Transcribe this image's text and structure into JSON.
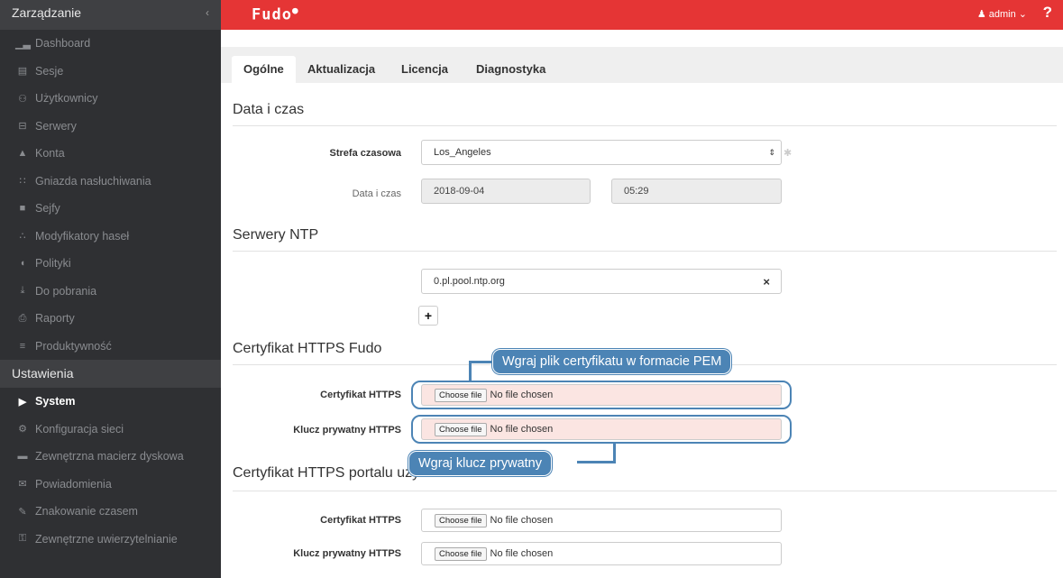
{
  "sidebar": {
    "header": "Zarządzanie",
    "collapse_icon": "chevron-left-icon",
    "items": [
      {
        "label": "Dashboard",
        "icon": "chart-icon"
      },
      {
        "label": "Sesje",
        "icon": "film-icon"
      },
      {
        "label": "Użytkownicy",
        "icon": "users-icon"
      },
      {
        "label": "Serwery",
        "icon": "server-icon"
      },
      {
        "label": "Konta",
        "icon": "user-account-icon"
      },
      {
        "label": "Gniazda nasłuchiwania",
        "icon": "rss-icon"
      },
      {
        "label": "Sejfy",
        "icon": "safe-icon"
      },
      {
        "label": "Modyfikatory haseł",
        "icon": "sitemap-icon"
      },
      {
        "label": "Polityki",
        "icon": "shield-icon"
      },
      {
        "label": "Do pobrania",
        "icon": "download-icon"
      },
      {
        "label": "Raporty",
        "icon": "printer-icon"
      },
      {
        "label": "Produktywność",
        "icon": "list-icon"
      }
    ],
    "section2": "Ustawienia",
    "items2": [
      {
        "label": "System",
        "icon": "folder-open-icon",
        "active": true
      },
      {
        "label": "Konfiguracja sieci",
        "icon": "cogs-icon"
      },
      {
        "label": "Zewnętrzna macierz dyskowa",
        "icon": "hdd-icon"
      },
      {
        "label": "Powiadomienia",
        "icon": "envelope-icon"
      },
      {
        "label": "Znakowanie czasem",
        "icon": "edit-icon"
      },
      {
        "label": "Zewnętrzne uwierzytelnianie",
        "icon": "key-icon"
      }
    ]
  },
  "topbar": {
    "logo": "Fudo",
    "user": "admin",
    "help": "?"
  },
  "tabs": [
    {
      "label": "Ogólne",
      "active": true
    },
    {
      "label": "Aktualizacja"
    },
    {
      "label": "Licencja"
    },
    {
      "label": "Diagnostyka"
    }
  ],
  "datetime": {
    "title": "Data i czas",
    "timezone_label": "Strefa czasowa",
    "timezone_value": "Los_Angeles",
    "date_label": "Data i czas",
    "date_value": "2018-09-04",
    "time_value": "05:29"
  },
  "ntp": {
    "title": "Serwery NTP",
    "server": "0.pl.pool.ntp.org",
    "remove": "×",
    "add": "+"
  },
  "https_fudo": {
    "title": "Certyfikat HTTPS Fudo",
    "cert_label": "Certyfikat HTTPS",
    "key_label": "Klucz prywatny HTTPS",
    "choose": "Choose file",
    "none": "No file chosen",
    "tip_cert": "Wgraj plik certyfikatu w formacie PEM",
    "tip_key": "Wgraj klucz prywatny"
  },
  "https_portal": {
    "title": "Certyfikat HTTPS portalu użytkownika",
    "cert_label": "Certyfikat HTTPS",
    "key_label": "Klucz prywatny HTTPS",
    "choose": "Choose file",
    "none": "No file chosen"
  }
}
